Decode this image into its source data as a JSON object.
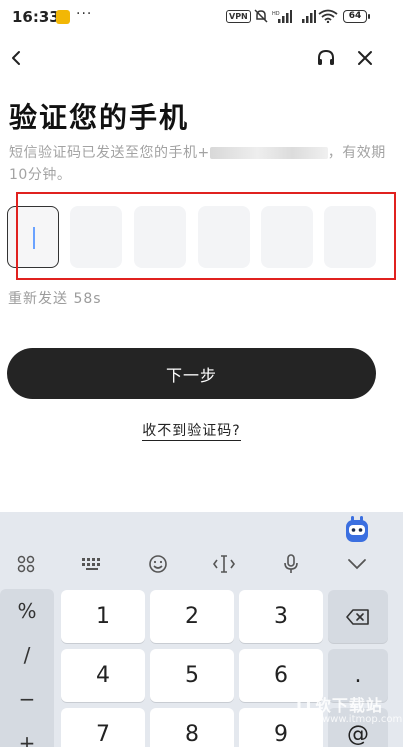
{
  "status_bar": {
    "time": "16:33",
    "notif_dots": "···",
    "vpn": "VPN",
    "battery": "64"
  },
  "nav": {
    "back_icon": "chevron-left-icon",
    "headset_icon": "headset-icon",
    "close_icon": "close-icon"
  },
  "main": {
    "title": "验证您的手机",
    "subtitle_prefix": "短信验证码已发送至您的手机+",
    "subtitle_suffix": "，有效期10分钟。",
    "code_boxes": [
      "",
      "",
      "",
      "",
      "",
      ""
    ],
    "resend_label": "重新发送 58s",
    "next_button": "下一步",
    "no_code_link": "收不到验证码?"
  },
  "keyboard": {
    "toolbar_icons": [
      "grid-icon",
      "keyboard-icon",
      "emoji-icon",
      "cursor-icon",
      "microphone-icon",
      "chevron-down-icon"
    ],
    "symbols": [
      "%",
      "/",
      "−",
      "+"
    ],
    "keys": [
      [
        "1",
        "2",
        "3"
      ],
      [
        "4",
        "5",
        "6"
      ],
      [
        "7",
        "8",
        "9"
      ]
    ],
    "right_keys": [
      "backspace-icon",
      ".",
      "@"
    ]
  },
  "watermark": {
    "text": "IT软下载站",
    "sub": "www.itmop.com"
  },
  "colors": {
    "annotation": "#e0211f",
    "primary_button": "#242424",
    "caret": "#6aa2ff"
  }
}
